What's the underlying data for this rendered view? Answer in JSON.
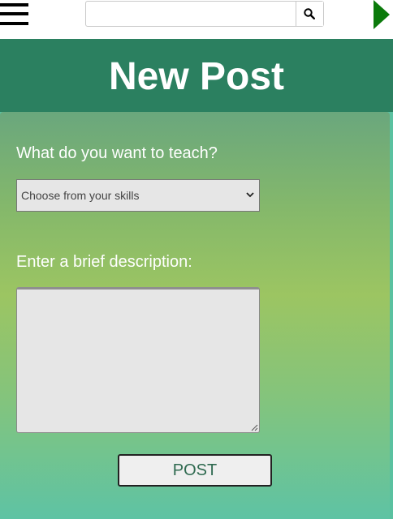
{
  "topbar": {
    "search": {
      "value": "",
      "placeholder": ""
    }
  },
  "header": {
    "title": "New Post"
  },
  "form": {
    "teach_label": "What do you want to teach?",
    "skill_select": {
      "selected": "Choose from your skills"
    },
    "description_label": "Enter a brief description:",
    "description_value": "",
    "post_button": "POST"
  },
  "colors": {
    "header_bg": "#2b8060",
    "next_arrow": "#0b7a0b",
    "button_text": "#2f6a50"
  }
}
